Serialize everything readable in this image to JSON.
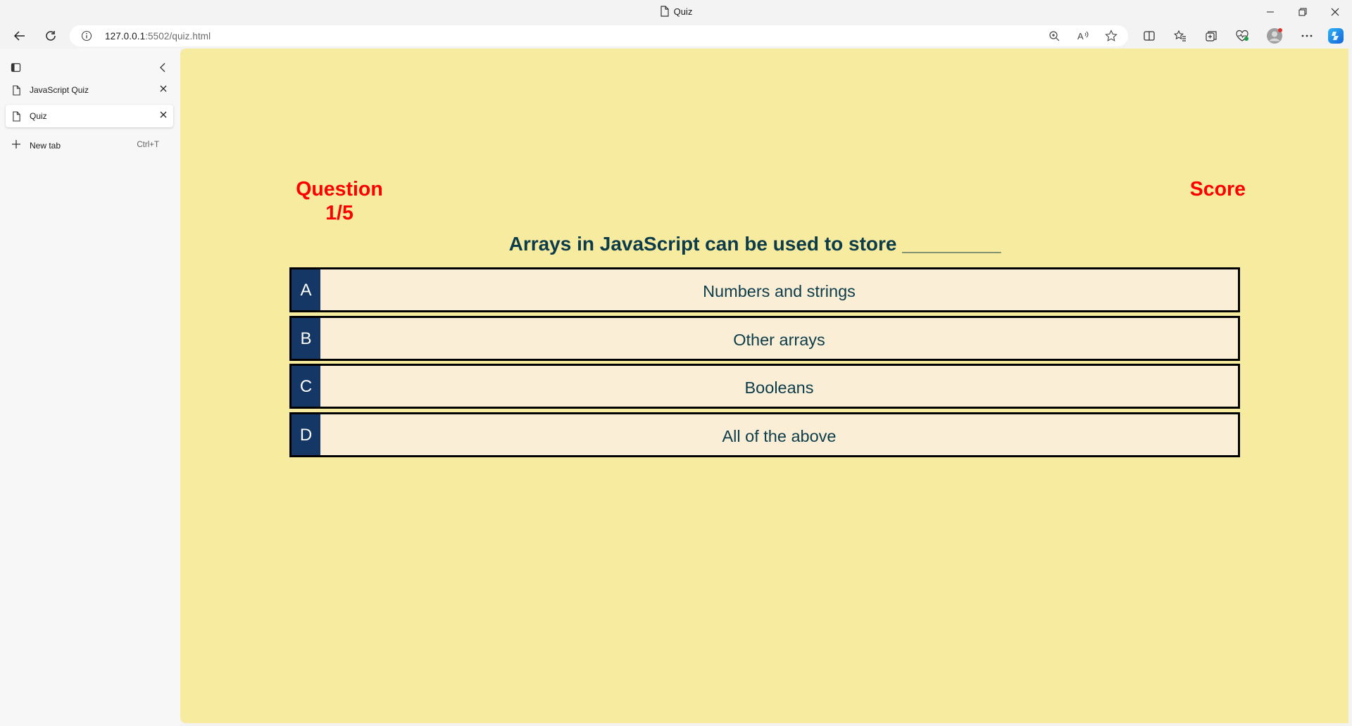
{
  "window": {
    "title": "Quiz"
  },
  "toolbar": {
    "url_host": "127.0.0.1",
    "url_path": ":5502/quiz.html"
  },
  "sidebar": {
    "tabs": [
      {
        "label": "JavaScript Quiz",
        "active": false
      },
      {
        "label": "Quiz",
        "active": true
      }
    ],
    "new_tab_label": "New tab",
    "new_tab_shortcut": "Ctrl+T"
  },
  "quiz": {
    "question_label": "Question 1/5",
    "score_label": "Score",
    "question_text": "Arrays in JavaScript can be used to store _________",
    "options": [
      {
        "letter": "A",
        "text": "Numbers and strings"
      },
      {
        "letter": "B",
        "text": "Other arrays"
      },
      {
        "letter": "C",
        "text": "Booleans"
      },
      {
        "letter": "D",
        "text": "All of the above"
      }
    ]
  },
  "colors": {
    "page_background": "#f7eb9f",
    "accent_red": "#ff0000",
    "option_letter_bg": "#143766",
    "option_bg": "#faeed6",
    "text_dark_teal": "#0c3c4a"
  }
}
